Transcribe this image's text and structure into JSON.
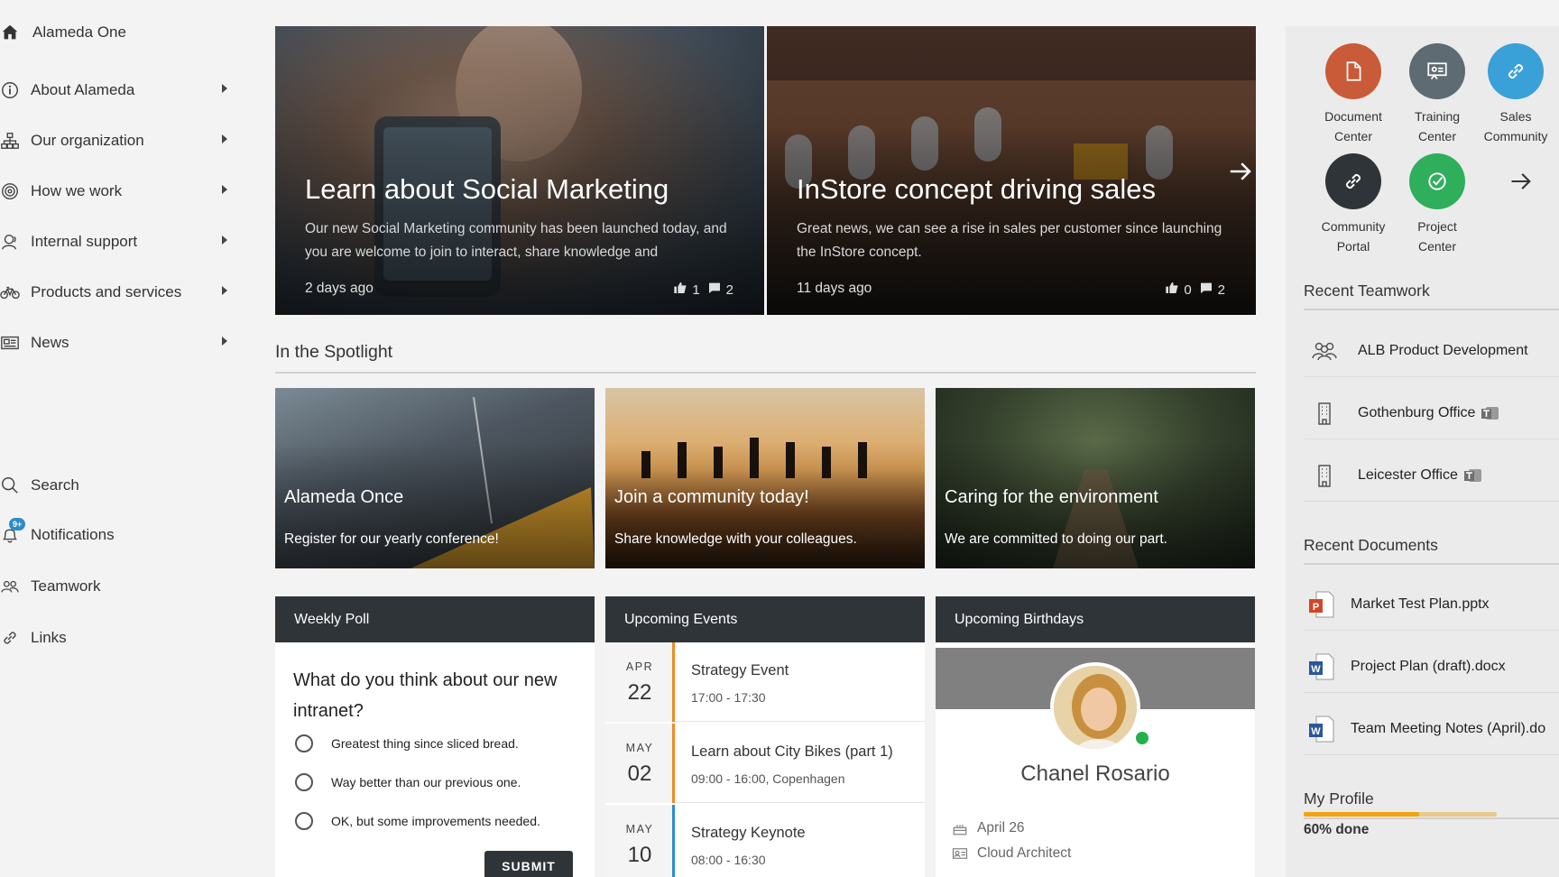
{
  "sidebar": {
    "home_label": "Alameda One",
    "nav": [
      {
        "label": "About Alameda",
        "icon": "info-icon"
      },
      {
        "label": "Our organization",
        "icon": "org-chart-icon"
      },
      {
        "label": "How we work",
        "icon": "target-icon"
      },
      {
        "label": "Internal support",
        "icon": "support-person-icon"
      },
      {
        "label": "Products and services",
        "icon": "bicycle-icon"
      },
      {
        "label": "News",
        "icon": "newspaper-icon"
      }
    ],
    "utility": [
      {
        "label": "Search",
        "icon": "search-icon"
      },
      {
        "label": "Notifications",
        "icon": "bell-icon",
        "badge": "9+"
      },
      {
        "label": "Teamwork",
        "icon": "people-icon"
      },
      {
        "label": "Links",
        "icon": "link-icon"
      }
    ]
  },
  "hero": [
    {
      "title": "Learn about Social Marketing",
      "description": "Our new Social Marketing community has been launched today, and you are welcome to join to interact, share knowledge and",
      "date": "2 days ago",
      "likes": "1",
      "comments": "2"
    },
    {
      "title": "InStore concept driving sales",
      "description": "Great news, we can see a rise in sales per customer since launching the InStore concept.",
      "date": "11 days ago",
      "likes": "0",
      "comments": "2"
    }
  ],
  "spotlight": {
    "title": "In the Spotlight",
    "items": [
      {
        "title": "Alameda Once",
        "subtitle": "Register for our yearly conference!"
      },
      {
        "title": "Join a community today!",
        "subtitle": "Share knowledge with your colleagues."
      },
      {
        "title": "Caring for the environment",
        "subtitle": "We are committed to doing our part."
      }
    ]
  },
  "poll": {
    "header": "Weekly Poll",
    "question": "What do you think about our new intranet?",
    "options": [
      "Greatest thing since sliced bread.",
      "Way better than our previous one.",
      "OK, but some improvements needed."
    ],
    "submit_label": "SUBMIT"
  },
  "events": {
    "header": "Upcoming Events",
    "items": [
      {
        "month": "APR",
        "day": "22",
        "name": "Strategy Event",
        "time": "17:00 - 17:30",
        "color": "#f08a24"
      },
      {
        "month": "MAY",
        "day": "02",
        "name": "Learn about City Bikes (part 1)",
        "time": "09:00 - 16:00, Copenhagen",
        "color": "#f08a24"
      },
      {
        "month": "MAY",
        "day": "10",
        "name": "Strategy Keynote",
        "time": "08:00 - 16:30",
        "color": "#2b8ccb"
      }
    ]
  },
  "birthdays": {
    "header": "Upcoming Birthdays",
    "name": "Chanel Rosario",
    "date": "April 26",
    "title": "Cloud Architect"
  },
  "apps": [
    {
      "label1": "Document",
      "label2": "Center",
      "color": "#c95b38",
      "icon": "document-icon"
    },
    {
      "label1": "Training",
      "label2": "Center",
      "color": "#5f6b73",
      "icon": "presentation-icon"
    },
    {
      "label1": "Sales",
      "label2": "Community",
      "color": "#3aa0d8",
      "icon": "link-icon"
    },
    {
      "label1": "Community",
      "label2": "Portal",
      "color": "#2f3439",
      "icon": "link-icon"
    },
    {
      "label1": "Project",
      "label2": "Center",
      "color": "#2fae5c",
      "icon": "target-check-icon"
    }
  ],
  "teamwork": {
    "title": "Recent Teamwork",
    "items": [
      {
        "label": "ALB Product Development",
        "icon": "people-icon",
        "teams": false
      },
      {
        "label": "Gothenburg Office",
        "icon": "building-icon",
        "teams": true
      },
      {
        "label": "Leicester Office",
        "icon": "building-icon",
        "teams": true
      }
    ]
  },
  "documents": {
    "title": "Recent Documents",
    "items": [
      {
        "label": "Market Test Plan.pptx",
        "icon": "powerpoint-icon"
      },
      {
        "label": "Project Plan (draft).docx",
        "icon": "word-icon"
      },
      {
        "label": "Team Meeting Notes (April).do",
        "icon": "word-icon"
      }
    ]
  },
  "profile": {
    "title": "My Profile",
    "progress": 0.6,
    "progress_label": "60% done"
  }
}
